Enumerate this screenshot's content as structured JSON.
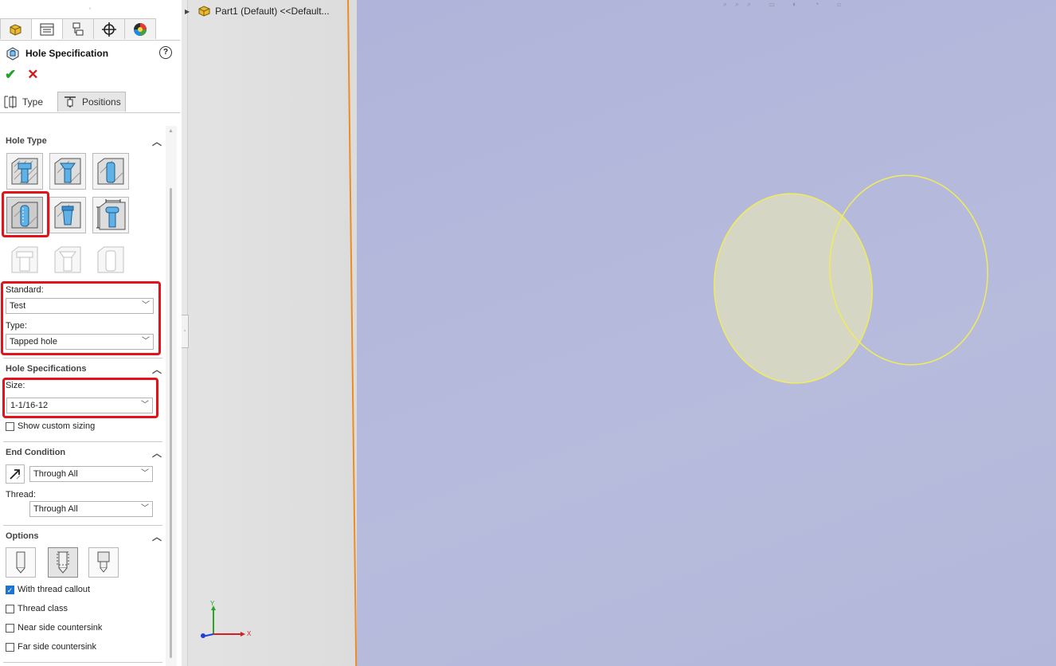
{
  "property_manager": {
    "title": "Hole Specification",
    "help": "?",
    "ok": "✔",
    "cancel": "✕",
    "tabs": {
      "type": "Type",
      "positions": "Positions"
    }
  },
  "hole_type": {
    "header": "Hole Type",
    "buttons": [
      {
        "name": "counterbore",
        "selected": false
      },
      {
        "name": "countersink",
        "selected": false
      },
      {
        "name": "hole",
        "selected": false
      },
      {
        "name": "straight-tap",
        "selected": true
      },
      {
        "name": "tapered-tap",
        "selected": false
      },
      {
        "name": "legacy-hole",
        "selected": false
      },
      {
        "name": "counterbore-slot",
        "disabled": true
      },
      {
        "name": "countersink-slot",
        "disabled": true
      },
      {
        "name": "slot",
        "disabled": true
      }
    ],
    "standard_label": "Standard:",
    "standard_value": "Test",
    "type_label": "Type:",
    "type_value": "Tapped hole"
  },
  "hole_specifications": {
    "header": "Hole Specifications",
    "size_label": "Size:",
    "size_value": "1-1/16-12",
    "custom_sizing": "Show custom sizing",
    "custom_sizing_checked": false
  },
  "end_condition": {
    "header": "End Condition",
    "end_value": "Through All",
    "thread_label": "Thread:",
    "thread_value": "Through All"
  },
  "options": {
    "header": "Options",
    "thread_callout": "With thread callout",
    "thread_callout_checked": true,
    "thread_class": "Thread class",
    "near_side": "Near side countersink",
    "far_side": "Far side countersink"
  },
  "feature_tree": {
    "root": "Part1 (Default) <<Default..."
  },
  "triad": {
    "x": "X",
    "y": "Y"
  },
  "colors": {
    "highlight": "#e0141a",
    "sketch": "#f0ec5a",
    "viewport": "#b5b8db",
    "edge": "#f08a24"
  }
}
